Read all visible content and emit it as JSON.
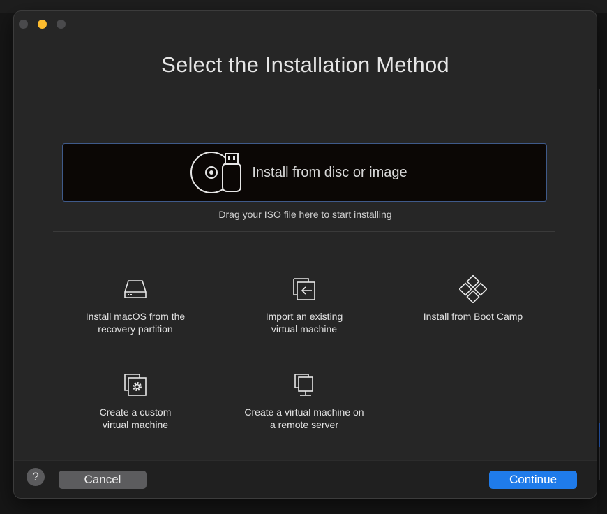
{
  "dialog": {
    "title": "Select the Installation Method"
  },
  "dropzone": {
    "label": "Install from disc or image",
    "hint": "Drag your ISO file here to start installing",
    "icon": "disc-usb-icon"
  },
  "options": [
    {
      "label": "Install macOS from the\nrecovery partition",
      "icon": "hard-drive-icon"
    },
    {
      "label": "Import an existing\nvirtual machine",
      "icon": "import-vm-icon"
    },
    {
      "label": "Install from Boot Camp",
      "icon": "boot-camp-icon"
    },
    {
      "label": "Create a custom\nvirtual machine",
      "icon": "custom-vm-gear-icon"
    },
    {
      "label": "Create a virtual machine on\na remote server",
      "icon": "remote-server-icon"
    }
  ],
  "footer": {
    "help_label": "?",
    "cancel_label": "Cancel",
    "continue_label": "Continue"
  },
  "colors": {
    "accent": "#1f7bea",
    "close": "#4a4a4c",
    "minimize": "#febc2e",
    "maximize": "#4a4a4c"
  }
}
